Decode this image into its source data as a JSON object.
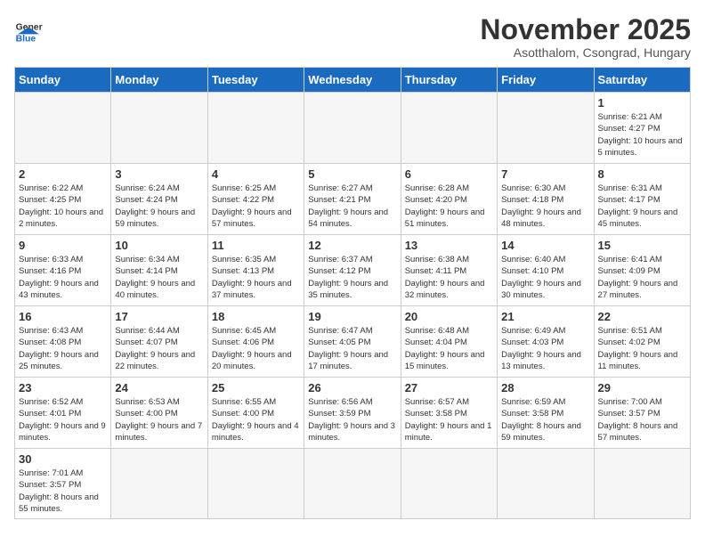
{
  "header": {
    "logo_general": "General",
    "logo_blue": "Blue",
    "title": "November 2025",
    "subtitle": "Asotthalom, Csongrad, Hungary"
  },
  "weekdays": [
    "Sunday",
    "Monday",
    "Tuesday",
    "Wednesday",
    "Thursday",
    "Friday",
    "Saturday"
  ],
  "weeks": [
    [
      {
        "day": "",
        "info": "",
        "empty": true
      },
      {
        "day": "",
        "info": "",
        "empty": true
      },
      {
        "day": "",
        "info": "",
        "empty": true
      },
      {
        "day": "",
        "info": "",
        "empty": true
      },
      {
        "day": "",
        "info": "",
        "empty": true
      },
      {
        "day": "",
        "info": "",
        "empty": true
      },
      {
        "day": "1",
        "info": "Sunrise: 6:21 AM\nSunset: 4:27 PM\nDaylight: 10 hours and 5 minutes."
      }
    ],
    [
      {
        "day": "2",
        "info": "Sunrise: 6:22 AM\nSunset: 4:25 PM\nDaylight: 10 hours and 2 minutes."
      },
      {
        "day": "3",
        "info": "Sunrise: 6:24 AM\nSunset: 4:24 PM\nDaylight: 9 hours and 59 minutes."
      },
      {
        "day": "4",
        "info": "Sunrise: 6:25 AM\nSunset: 4:22 PM\nDaylight: 9 hours and 57 minutes."
      },
      {
        "day": "5",
        "info": "Sunrise: 6:27 AM\nSunset: 4:21 PM\nDaylight: 9 hours and 54 minutes."
      },
      {
        "day": "6",
        "info": "Sunrise: 6:28 AM\nSunset: 4:20 PM\nDaylight: 9 hours and 51 minutes."
      },
      {
        "day": "7",
        "info": "Sunrise: 6:30 AM\nSunset: 4:18 PM\nDaylight: 9 hours and 48 minutes."
      },
      {
        "day": "8",
        "info": "Sunrise: 6:31 AM\nSunset: 4:17 PM\nDaylight: 9 hours and 45 minutes."
      }
    ],
    [
      {
        "day": "9",
        "info": "Sunrise: 6:33 AM\nSunset: 4:16 PM\nDaylight: 9 hours and 43 minutes."
      },
      {
        "day": "10",
        "info": "Sunrise: 6:34 AM\nSunset: 4:14 PM\nDaylight: 9 hours and 40 minutes."
      },
      {
        "day": "11",
        "info": "Sunrise: 6:35 AM\nSunset: 4:13 PM\nDaylight: 9 hours and 37 minutes."
      },
      {
        "day": "12",
        "info": "Sunrise: 6:37 AM\nSunset: 4:12 PM\nDaylight: 9 hours and 35 minutes."
      },
      {
        "day": "13",
        "info": "Sunrise: 6:38 AM\nSunset: 4:11 PM\nDaylight: 9 hours and 32 minutes."
      },
      {
        "day": "14",
        "info": "Sunrise: 6:40 AM\nSunset: 4:10 PM\nDaylight: 9 hours and 30 minutes."
      },
      {
        "day": "15",
        "info": "Sunrise: 6:41 AM\nSunset: 4:09 PM\nDaylight: 9 hours and 27 minutes."
      }
    ],
    [
      {
        "day": "16",
        "info": "Sunrise: 6:43 AM\nSunset: 4:08 PM\nDaylight: 9 hours and 25 minutes."
      },
      {
        "day": "17",
        "info": "Sunrise: 6:44 AM\nSunset: 4:07 PM\nDaylight: 9 hours and 22 minutes."
      },
      {
        "day": "18",
        "info": "Sunrise: 6:45 AM\nSunset: 4:06 PM\nDaylight: 9 hours and 20 minutes."
      },
      {
        "day": "19",
        "info": "Sunrise: 6:47 AM\nSunset: 4:05 PM\nDaylight: 9 hours and 17 minutes."
      },
      {
        "day": "20",
        "info": "Sunrise: 6:48 AM\nSunset: 4:04 PM\nDaylight: 9 hours and 15 minutes."
      },
      {
        "day": "21",
        "info": "Sunrise: 6:49 AM\nSunset: 4:03 PM\nDaylight: 9 hours and 13 minutes."
      },
      {
        "day": "22",
        "info": "Sunrise: 6:51 AM\nSunset: 4:02 PM\nDaylight: 9 hours and 11 minutes."
      }
    ],
    [
      {
        "day": "23",
        "info": "Sunrise: 6:52 AM\nSunset: 4:01 PM\nDaylight: 9 hours and 9 minutes."
      },
      {
        "day": "24",
        "info": "Sunrise: 6:53 AM\nSunset: 4:00 PM\nDaylight: 9 hours and 7 minutes."
      },
      {
        "day": "25",
        "info": "Sunrise: 6:55 AM\nSunset: 4:00 PM\nDaylight: 9 hours and 4 minutes."
      },
      {
        "day": "26",
        "info": "Sunrise: 6:56 AM\nSunset: 3:59 PM\nDaylight: 9 hours and 3 minutes."
      },
      {
        "day": "27",
        "info": "Sunrise: 6:57 AM\nSunset: 3:58 PM\nDaylight: 9 hours and 1 minute."
      },
      {
        "day": "28",
        "info": "Sunrise: 6:59 AM\nSunset: 3:58 PM\nDaylight: 8 hours and 59 minutes."
      },
      {
        "day": "29",
        "info": "Sunrise: 7:00 AM\nSunset: 3:57 PM\nDaylight: 8 hours and 57 minutes."
      }
    ],
    [
      {
        "day": "30",
        "info": "Sunrise: 7:01 AM\nSunset: 3:57 PM\nDaylight: 8 hours and 55 minutes."
      },
      {
        "day": "",
        "info": "",
        "empty": true
      },
      {
        "day": "",
        "info": "",
        "empty": true
      },
      {
        "day": "",
        "info": "",
        "empty": true
      },
      {
        "day": "",
        "info": "",
        "empty": true
      },
      {
        "day": "",
        "info": "",
        "empty": true
      },
      {
        "day": "",
        "info": "",
        "empty": true
      }
    ]
  ]
}
